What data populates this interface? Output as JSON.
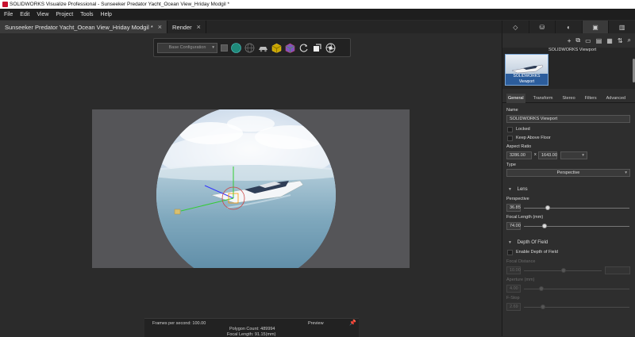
{
  "window": {
    "title": "SOLIDWORKS Visualize Professional - Sunseeker Predator Yacht_Ocean View_Hriday Modgil *"
  },
  "menu": {
    "items": [
      "File",
      "Edit",
      "View",
      "Project",
      "Tools",
      "Help"
    ]
  },
  "tabs": [
    {
      "label": "Sunseeker Predator Yacht_Ocean View_Hriday Modgil *",
      "close": "×"
    },
    {
      "label": "Render",
      "close": "×"
    }
  ],
  "toolbar": {
    "configuration": "Base Configuration",
    "icons": [
      "sphere-icon",
      "globe-icon",
      "car-icon",
      "cube-icon",
      "cube-select-icon",
      "refresh-icon",
      "transform-icon",
      "aperture-icon"
    ]
  },
  "status": {
    "fps": "Frames per second: 100.00",
    "polygon": "Polygon Count: 489994",
    "focal": "Focal Length: 91.15(mm)",
    "preview": "Preview"
  },
  "right_panel": {
    "tabs": [
      "model-icon",
      "appearance-icon",
      "scene-icon",
      "camera-icon",
      "library-icon"
    ],
    "camera": {
      "thumb_label": "SOLIDWORKS Viewport",
      "name": "SOLIDWORKS Viewport"
    },
    "subtabs": [
      "General",
      "Transform",
      "Stereo",
      "Filters",
      "Advanced"
    ],
    "general": {
      "name_label": "Name",
      "name_value": "SOLIDWORKS Viewport",
      "locked": "Locked",
      "keep_above": "Keep Above Floor",
      "aspect_label": "Aspect Ratio",
      "aspect_w": "3286.00",
      "aspect_x": "x",
      "aspect_h": "1643.00",
      "type_label": "Type",
      "type_value": "Perspective",
      "lens_section": "Lens",
      "perspective_label": "Perspective",
      "perspective_value": "36.85",
      "focal_label": "Focal Length (mm)",
      "focal_value": "74.00",
      "dof_section": "Depth Of Field",
      "enable_dof": "Enable Depth of Field",
      "focal_distance_label": "Focal Distance",
      "focal_distance_value": "10.00",
      "aperture_label": "Aperture (mm)",
      "aperture_value": "4.00",
      "fstop_label": "F-Stop",
      "fstop_value": "2.69"
    }
  },
  "colors": {
    "accent": "#2c5d9c",
    "panel": "#2e2e2e",
    "background": "#2b2b2b"
  }
}
